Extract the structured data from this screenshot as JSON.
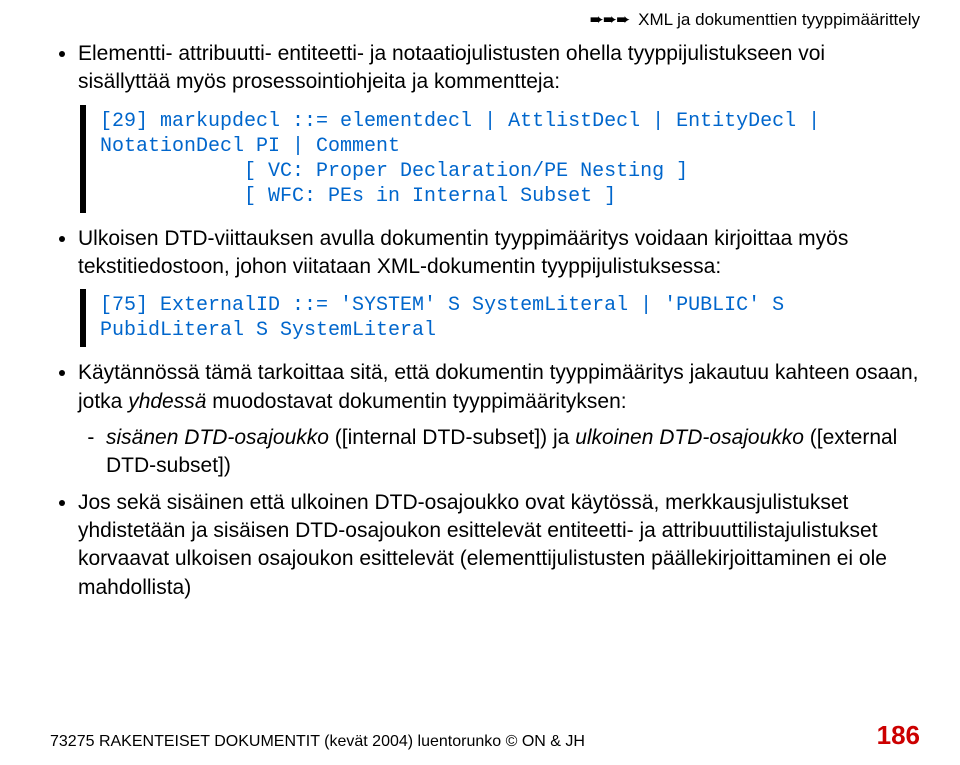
{
  "header": {
    "arrows": "➨➨➨",
    "text": "XML ja dokumenttien tyyppimäärittely"
  },
  "b1": {
    "l1": "Elementti- attribuutti- entiteetti- ja notaatiojulistusten ohella tyyppijulistukseen voi sisällyttää myös prosessointiohjeita ja kommentteja:"
  },
  "code1": {
    "line1": "[29] markupdecl ::= elementdecl | AttlistDecl | EntityDecl | NotationDecl PI | Comment",
    "line2": "[ VC: Proper Declaration/PE Nesting ]",
    "line3": "[ WFC: PEs in Internal Subset ]"
  },
  "b2": {
    "l1": "Ulkoisen DTD-viittauksen avulla dokumentin tyyppimääritys voidaan kirjoittaa myös tekstitiedostoon, johon viitataan XML-dokumentin tyyppijulistuksessa:"
  },
  "code2": {
    "line1": "[75] ExternalID ::= 'SYSTEM' S SystemLiteral | 'PUBLIC' S PubidLiteral S SystemLiteral"
  },
  "b3": {
    "l1_a": "Käytännössä tämä tarkoittaa sitä, että dokumentin tyyppimääritys jakautuu kahteen osaan, jotka ",
    "l1_b": "yhdessä",
    "l1_c": " muodostavat dokumentin tyyppimäärityksen:",
    "sub_a": "sisänen DTD-osajoukko",
    "sub_b": " ([internal DTD-subset]) ja ",
    "sub_c": "ulkoinen DTD-osajoukko",
    "sub_d": " ([external DTD-subset])"
  },
  "b4": {
    "l1": "Jos sekä sisäinen että ulkoinen DTD-osajoukko ovat käytössä, merkkausjulistukset yhdistetään ja sisäisen DTD-osajoukon esittelevät entiteetti- ja attribuuttilistajulistukset korvaavat ulkoisen osajoukon esittelevät (elementtijulistusten päällekirjoittaminen ei ole mahdollista)"
  },
  "footer": {
    "left": "73275 RAKENTEISET DOKUMENTIT (kevät 2004) luentorunko © ON & JH",
    "right": "186"
  }
}
